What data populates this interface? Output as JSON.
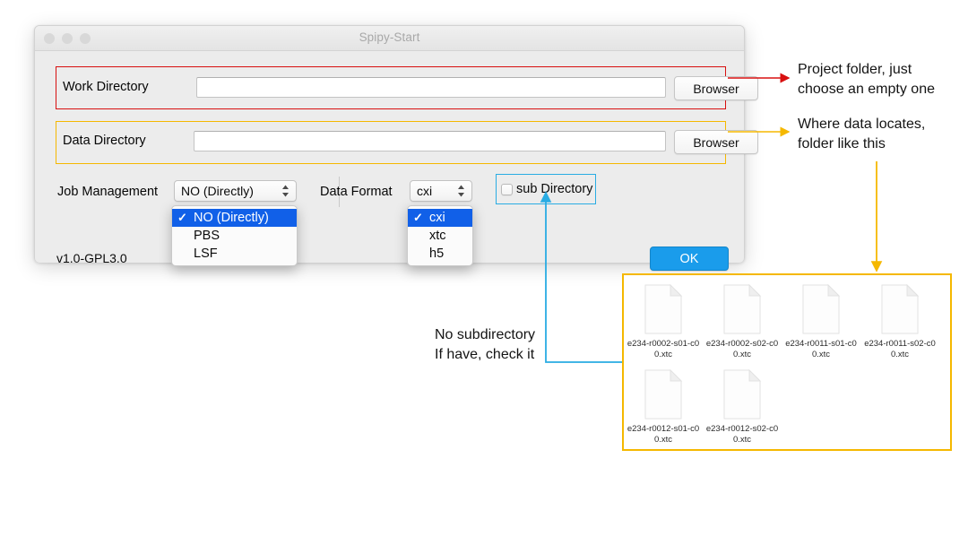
{
  "window": {
    "title": "Spipy-Start",
    "traffic_lights": [
      "close",
      "minimize",
      "zoom"
    ],
    "work_directory": {
      "label": "Work Directory",
      "value": "",
      "placeholder": "",
      "browse_label": "Browser",
      "highlight_color": "#d81010"
    },
    "data_directory": {
      "label": "Data Directory",
      "value": "",
      "placeholder": "",
      "browse_label": "Browser",
      "highlight_color": "#f5b800"
    },
    "job_management": {
      "label": "Job Management",
      "selected": "NO (Directly)",
      "options": [
        "NO (Directly)",
        "PBS",
        "LSF"
      ],
      "open": true
    },
    "data_format": {
      "label": "Data Format",
      "selected": "cxi",
      "options": [
        "cxi",
        "xtc",
        "h5"
      ],
      "open": true
    },
    "sub_directory": {
      "label": "sub Directory",
      "checked": false,
      "highlight_color": "#29ace3"
    },
    "version": "v1.0-GPL3.0",
    "ok_label": "OK",
    "ok_color": "#1a9ceb"
  },
  "annotations": {
    "work_dir_note": "Project folder, just\nchoose an empty one",
    "data_dir_note": "Where data locates,\nfolder like this",
    "sub_dir_note": "No subdirectory\nIf have, check it",
    "colors": {
      "red": "#d81010",
      "yellow": "#f5b800",
      "cyan": "#29ace3"
    }
  },
  "file_browser": {
    "border_color": "#f5b800",
    "files": [
      "e234-r0002-s01-c00.xtc",
      "e234-r0002-s02-c00.xtc",
      "e234-r0011-s01-c00.xtc",
      "e234-r0011-s02-c00.xtc",
      "e234-r0012-s01-c00.xtc",
      "e234-r0012-s02-c00.xtc"
    ]
  }
}
